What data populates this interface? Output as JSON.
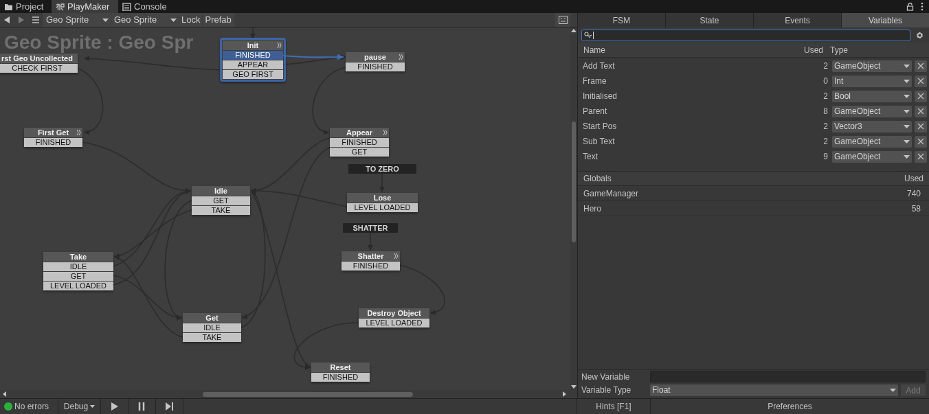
{
  "window_tabs": [
    {
      "label": "Project",
      "selected": false
    },
    {
      "label": "PlayMaker",
      "selected": true
    },
    {
      "label": "Console",
      "selected": false
    }
  ],
  "toolbar": {
    "dropdowns": [
      "Geo Sprite",
      "Geo Sprite"
    ],
    "buttons": [
      "Lock",
      "Prefab"
    ]
  },
  "graph": {
    "title": "Geo Sprite : Geo Spr",
    "states": [
      {
        "kind": "state",
        "title": "rst Geo Uncollected",
        "selected": false,
        "has_actions": false,
        "events": [
          {
            "label": "CHECK FIRST",
            "selected": false
          }
        ]
      },
      {
        "kind": "state",
        "title": "Init",
        "selected": true,
        "has_actions": true,
        "events": [
          {
            "label": "FINISHED",
            "selected": true
          },
          {
            "label": "APPEAR",
            "selected": false
          },
          {
            "label": "GEO FIRST",
            "selected": false
          }
        ]
      },
      {
        "kind": "state",
        "title": "pause",
        "selected": false,
        "has_actions": true,
        "events": [
          {
            "label": "FINISHED",
            "selected": false
          }
        ]
      },
      {
        "kind": "state",
        "title": "First Get",
        "selected": false,
        "has_actions": true,
        "events": [
          {
            "label": "FINISHED",
            "selected": false
          }
        ]
      },
      {
        "kind": "state",
        "title": "Appear",
        "selected": false,
        "has_actions": true,
        "events": [
          {
            "label": "FINISHED",
            "selected": false
          },
          {
            "label": "GET",
            "selected": false
          }
        ]
      },
      {
        "kind": "global_event",
        "label": "TO ZERO"
      },
      {
        "kind": "state",
        "title": "Idle",
        "selected": false,
        "has_actions": false,
        "events": [
          {
            "label": "GET",
            "selected": false
          },
          {
            "label": "TAKE",
            "selected": false
          }
        ]
      },
      {
        "kind": "state",
        "title": "Lose",
        "selected": false,
        "has_actions": false,
        "events": [
          {
            "label": "LEVEL LOADED",
            "selected": false
          }
        ]
      },
      {
        "kind": "global_event",
        "label": "SHATTER"
      },
      {
        "kind": "state",
        "title": "Take",
        "selected": false,
        "has_actions": false,
        "events": [
          {
            "label": "IDLE",
            "selected": false
          },
          {
            "label": "GET",
            "selected": false
          },
          {
            "label": "LEVEL LOADED",
            "selected": false
          }
        ]
      },
      {
        "kind": "state",
        "title": "Shatter",
        "selected": false,
        "has_actions": true,
        "events": [
          {
            "label": "FINISHED",
            "selected": false
          }
        ]
      },
      {
        "kind": "state",
        "title": "Get",
        "selected": false,
        "has_actions": false,
        "events": [
          {
            "label": "IDLE",
            "selected": false
          },
          {
            "label": "TAKE",
            "selected": false
          }
        ]
      },
      {
        "kind": "state",
        "title": "Destroy Object",
        "selected": false,
        "has_actions": false,
        "events": [
          {
            "label": "LEVEL LOADED",
            "selected": false
          }
        ]
      },
      {
        "kind": "state",
        "title": "Reset",
        "selected": false,
        "has_actions": false,
        "events": [
          {
            "label": "FINISHED",
            "selected": false
          }
        ]
      }
    ]
  },
  "inspector": {
    "tabs": [
      {
        "label": "FSM",
        "selected": false
      },
      {
        "label": "State",
        "selected": false
      },
      {
        "label": "Events",
        "selected": false
      },
      {
        "label": "Variables",
        "selected": true
      }
    ],
    "columns": [
      "Name",
      "Used",
      "Type"
    ],
    "variables": [
      {
        "name": "Add Text",
        "used": "2",
        "type": "GameObject"
      },
      {
        "name": "Frame",
        "used": "0",
        "type": "Int"
      },
      {
        "name": "Initialised",
        "used": "2",
        "type": "Bool"
      },
      {
        "name": "Parent",
        "used": "8",
        "type": "GameObject"
      },
      {
        "name": "Start Pos",
        "used": "2",
        "type": "Vector3"
      },
      {
        "name": "Sub Text",
        "used": "2",
        "type": "GameObject"
      },
      {
        "name": "Text",
        "used": "9",
        "type": "GameObject"
      }
    ],
    "globals_columns": [
      "Globals",
      "Used"
    ],
    "globals": [
      {
        "name": "GameManager",
        "used": "740"
      },
      {
        "name": "Hero",
        "used": "58"
      }
    ],
    "new_variable_label": "New Variable",
    "variable_type_label": "Variable Type",
    "variable_type": "Float",
    "add_button": {
      "label": "Add",
      "disabled": true
    }
  },
  "status_bar": {
    "errors": "No errors",
    "debug": "Debug",
    "hints": "Hints [F1]",
    "preferences": "Preferences"
  }
}
